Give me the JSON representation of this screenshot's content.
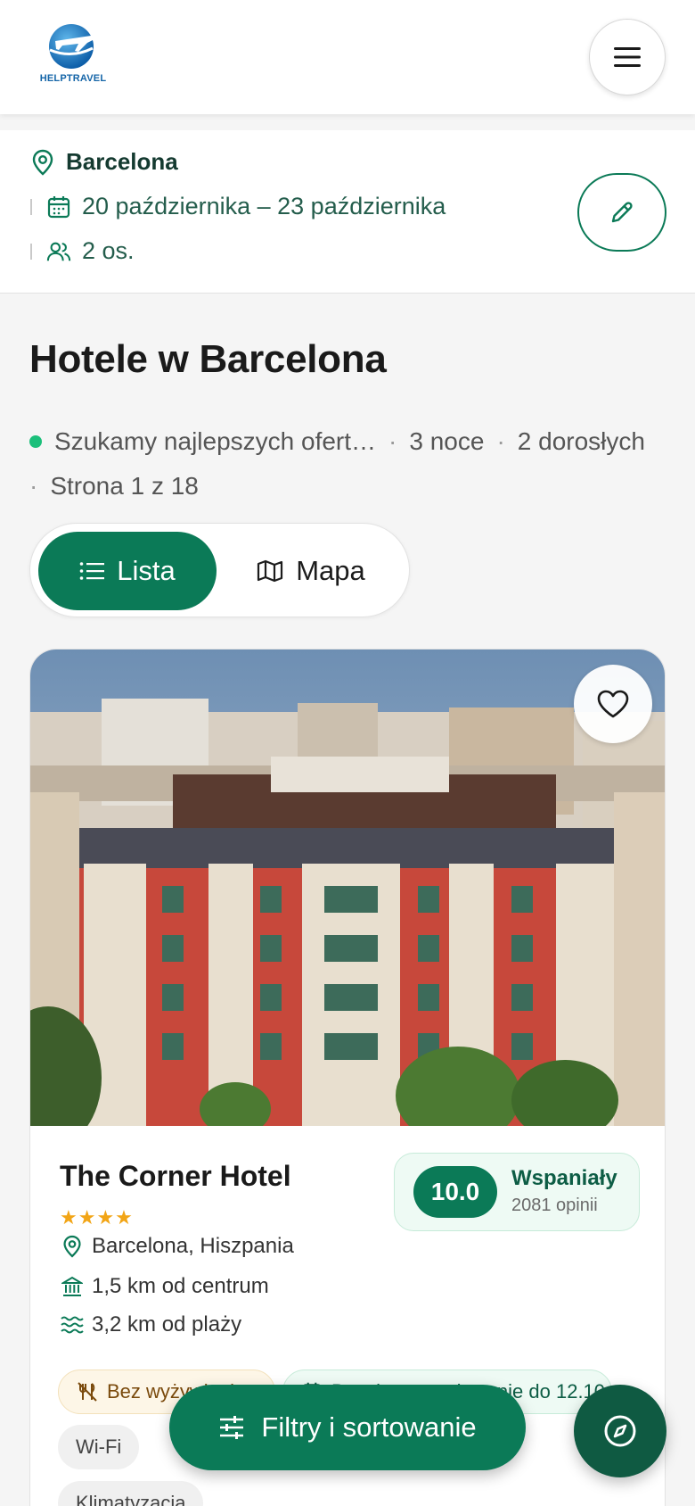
{
  "header": {
    "logo_text": "HELPTRAVEL",
    "menu_icon": "hamburger-icon"
  },
  "search_summary": {
    "city": "Barcelona",
    "dates": "20 października – 23 października",
    "guests": "2 os.",
    "edit_icon": "pencil-icon"
  },
  "results": {
    "title": "Hotele w Barcelona",
    "status": "Szukamy najlepszych ofert…",
    "nights": "3 noce",
    "adults": "2 dorosłych",
    "page": "Strona 1 z 18"
  },
  "view_toggle": {
    "list_label": "Lista",
    "map_label": "Mapa",
    "selected": "list"
  },
  "hotel": {
    "name": "The Corner Hotel",
    "stars": "★★★★",
    "star_count": 4,
    "location": "Barcelona, Hiszpania",
    "center_distance": "1,5 km od centrum",
    "beach_distance": "3,2 km od plaży",
    "score": "10.0",
    "rating_label": "Wspaniały",
    "reviews": "2081 opinii",
    "chips": {
      "food": "Bez wyżywienia",
      "cancel": "Bezpłatne anulowanie do 12.10",
      "wifi": "Wi-Fi",
      "air": "Klimatyzacja"
    }
  },
  "fab": {
    "filters_label": "Filtry i sortowanie",
    "compass_icon": "compass-icon"
  },
  "colors": {
    "primary": "#0b7a57",
    "primary_dark": "#0f5a42",
    "star": "#f2a516",
    "status_dot": "#1bbf7a"
  }
}
